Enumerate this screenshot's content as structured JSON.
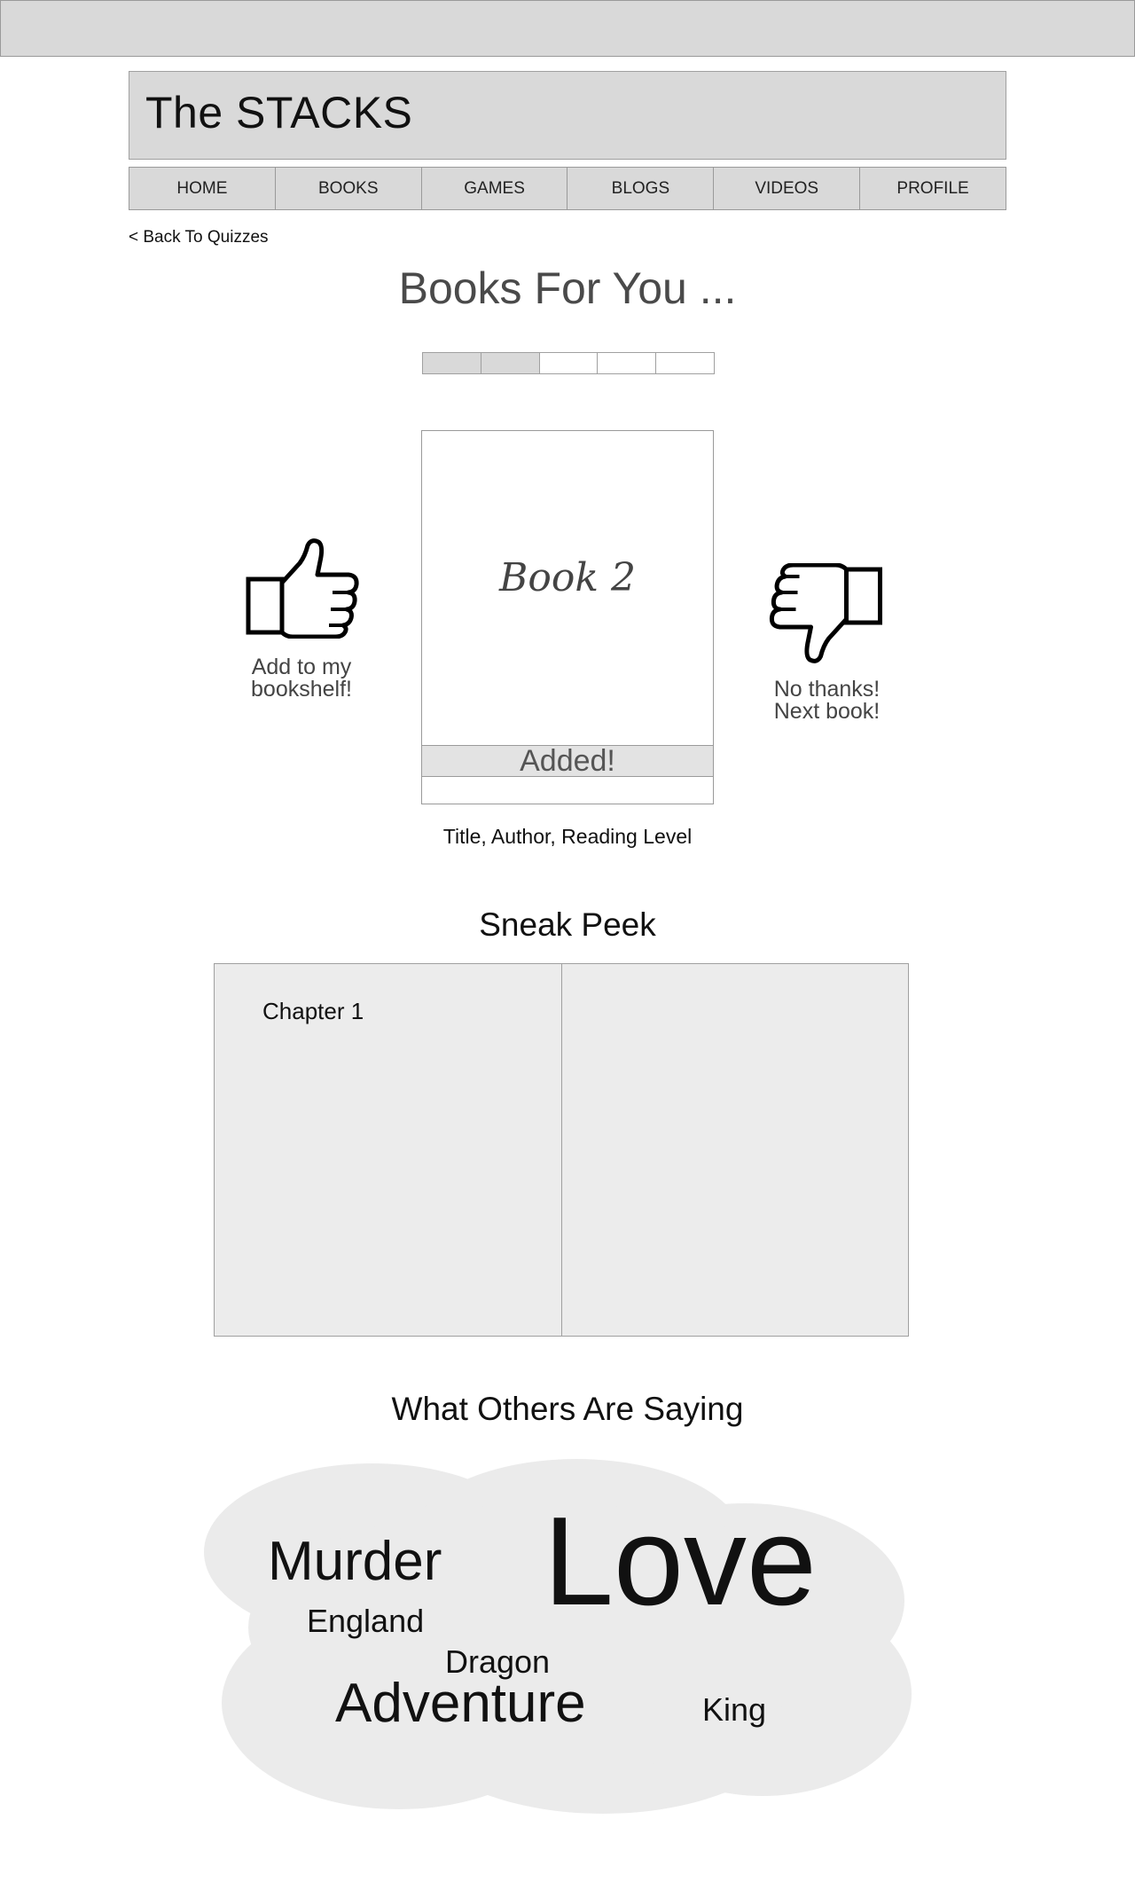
{
  "header": {
    "title": "The STACKS"
  },
  "nav": {
    "items": [
      {
        "label": "HOME"
      },
      {
        "label": "BOOKS"
      },
      {
        "label": "GAMES"
      },
      {
        "label": "BLOGS"
      },
      {
        "label": "VIDEOS"
      },
      {
        "label": "PROFILE"
      }
    ]
  },
  "back_link": "< Back To Quizzes",
  "heading": "Books For You ...",
  "progress": {
    "completed": 2,
    "total": 5
  },
  "card": {
    "title": "Book 2",
    "status": "Added!",
    "info": "Title, Author, Reading Level"
  },
  "like": {
    "line1": "Add to my",
    "line2": "bookshelf!",
    "icon": "thumbs-up-icon"
  },
  "dislike": {
    "line1": "No thanks!",
    "line2": "Next book!",
    "icon": "thumbs-down-icon"
  },
  "sneak_peek": {
    "heading": "Sneak Peek",
    "chapter": "Chapter 1"
  },
  "reviews": {
    "heading": "What Others Are Saying",
    "words": [
      "Murder",
      "England",
      "Love",
      "Dragon",
      "Adventure",
      "King"
    ]
  },
  "colors": {
    "panel": "#d9d9d9",
    "border": "#9a9a9a",
    "peek_bg": "#ececec",
    "cloud": "#ebebeb"
  }
}
